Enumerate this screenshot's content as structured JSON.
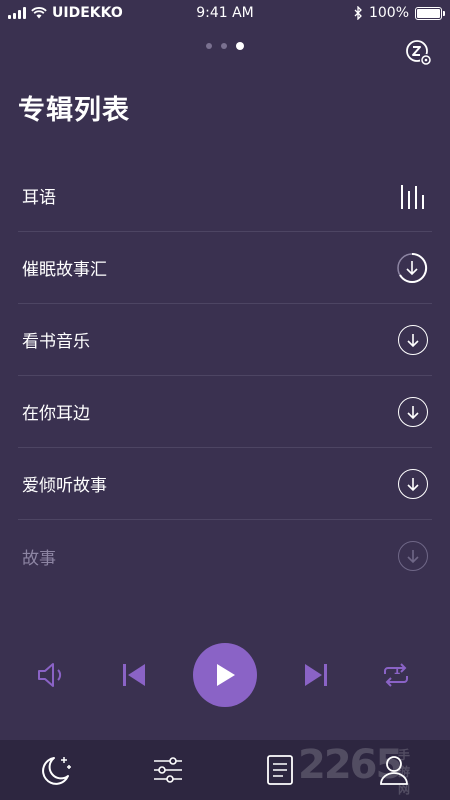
{
  "status_bar": {
    "carrier": "UIDEKKO",
    "time": "9:41 AM",
    "battery": "100%"
  },
  "pager": {
    "count": 3,
    "active_index": 2
  },
  "page_title": "专辑列表",
  "albums": [
    {
      "name": "耳语",
      "status_icon": "equalizer-bars-icon"
    },
    {
      "name": "催眠故事汇",
      "status_icon": "download-progress-icon"
    },
    {
      "name": "看书音乐",
      "status_icon": "download-icon"
    },
    {
      "name": "在你耳边",
      "status_icon": "download-icon"
    },
    {
      "name": "爱倾听故事",
      "status_icon": "download-icon"
    },
    {
      "name": "故事",
      "status_icon": "download-icon"
    }
  ],
  "player": {
    "accent_color": "#8a63c6",
    "repeat_count": "1"
  },
  "watermark": {
    "brand": "2265",
    "suffix": "手游网"
  },
  "colors": {
    "background": "#3a3150",
    "tab_bar": "#2d2640",
    "accent": "#8a63c6"
  }
}
